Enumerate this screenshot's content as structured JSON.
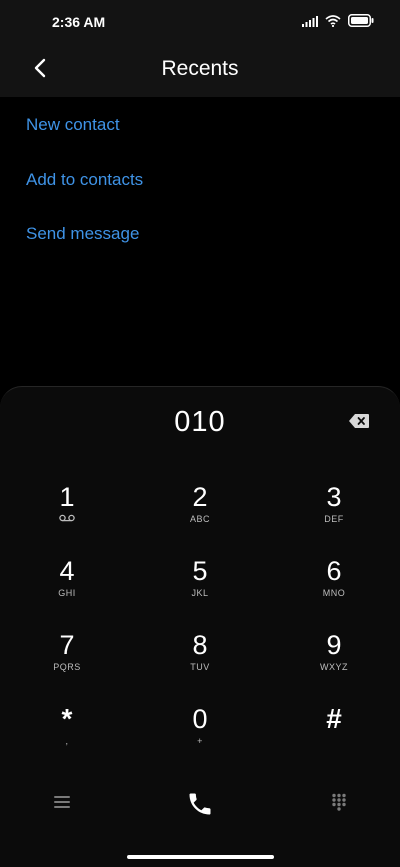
{
  "status_bar": {
    "time": "2:36 AM"
  },
  "header": {
    "title": "Recents"
  },
  "actions": [
    {
      "label": "New contact"
    },
    {
      "label": "Add to contacts"
    },
    {
      "label": "Send message"
    }
  ],
  "dialpad": {
    "number": "010",
    "keys": [
      {
        "digit": "1",
        "letters": ""
      },
      {
        "digit": "2",
        "letters": "ABC"
      },
      {
        "digit": "3",
        "letters": "DEF"
      },
      {
        "digit": "4",
        "letters": "GHI"
      },
      {
        "digit": "5",
        "letters": "JKL"
      },
      {
        "digit": "6",
        "letters": "MNO"
      },
      {
        "digit": "7",
        "letters": "PQRS"
      },
      {
        "digit": "8",
        "letters": "TUV"
      },
      {
        "digit": "9",
        "letters": "WXYZ"
      },
      {
        "digit": "*",
        "letters": ","
      },
      {
        "digit": "0",
        "letters": "+"
      },
      {
        "digit": "#",
        "letters": ""
      }
    ]
  },
  "colors": {
    "accent": "#3f93e6",
    "background": "#000000",
    "panel": "#0b0b0b"
  },
  "icons": [
    "signal-icon",
    "wifi-icon",
    "battery-icon",
    "back-arrow-icon",
    "backspace-icon",
    "voicemail-icon",
    "menu-icon",
    "phone-icon",
    "dialpad-grid-icon"
  ]
}
